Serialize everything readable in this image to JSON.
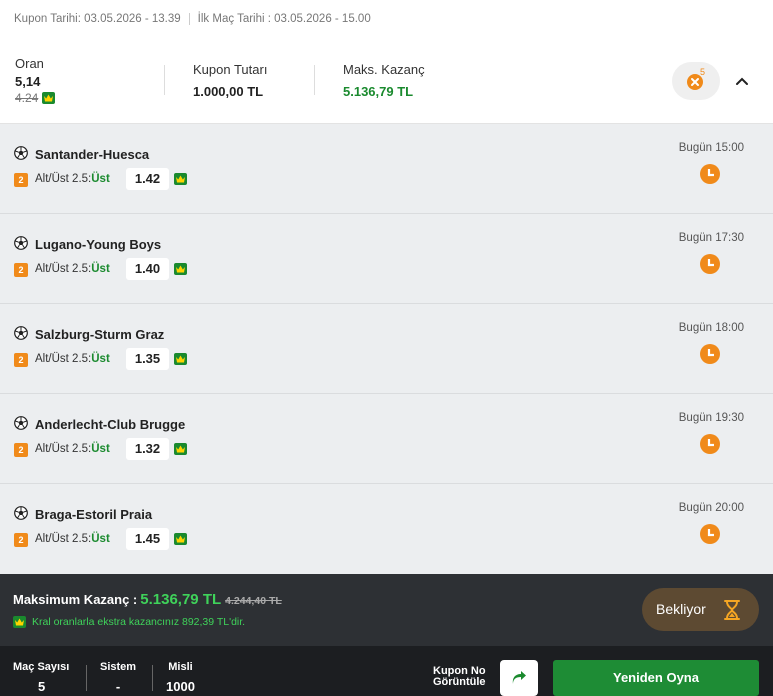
{
  "header": {
    "coupon_date": "Kupon Tarihi: 03.05.2026 - 13.39",
    "first_match_label": "İlk Maç Tarihi : ",
    "first_match_value": "03.05.2026 - 15.00"
  },
  "summary": {
    "odds_label": "Oran",
    "odds_value": "5,14",
    "odds_old": "4.24",
    "stake_label": "Kupon Tutarı",
    "stake_value": "1.000,00 TL",
    "max_win_label": "Maks. Kazanç",
    "max_win_value": "5.136,79 TL",
    "share_count": "5"
  },
  "matches": [
    {
      "name": "Santander-Huesca",
      "count": "2",
      "market": "Alt/Üst 2.5:",
      "pick": "Üst",
      "odd": "1.42",
      "time": "Bugün 15:00"
    },
    {
      "name": "Lugano-Young Boys",
      "count": "2",
      "market": "Alt/Üst 2.5:",
      "pick": "Üst",
      "odd": "1.40",
      "time": "Bugün 17:30"
    },
    {
      "name": "Salzburg-Sturm Graz",
      "count": "2",
      "market": "Alt/Üst 2.5:",
      "pick": "Üst",
      "odd": "1.35",
      "time": "Bugün 18:00"
    },
    {
      "name": "Anderlecht-Club Brugge",
      "count": "2",
      "market": "Alt/Üst 2.5:",
      "pick": "Üst",
      "odd": "1.32",
      "time": "Bugün 19:30"
    },
    {
      "name": "Braga-Estoril Praia",
      "count": "2",
      "market": "Alt/Üst 2.5:",
      "pick": "Üst",
      "odd": "1.45",
      "time": "Bugün 20:00"
    }
  ],
  "footer": {
    "max_win_label": "Maksimum Kazanç :",
    "max_win_value": "5.136,79 TL",
    "max_win_old": "4.244,40 TL",
    "bonus_text": "Kral oranlarla ekstra kazancınız 892,39 TL'dir.",
    "status_label": "Bekliyor"
  },
  "bottom": {
    "match_count_label": "Maç Sayısı",
    "match_count_value": "5",
    "system_label": "Sistem",
    "system_value": "-",
    "multiplier_label": "Misli",
    "multiplier_value": "1000",
    "coupon_no_line1": "Kupon No",
    "coupon_no_line2": "Görüntüle",
    "replay_label": "Yeniden Oyna"
  },
  "colors": {
    "accent_green": "#1a8a2e",
    "accent_orange": "#f08a1a",
    "footer_bg": "#2d3034",
    "bonus_green": "#3fd25a"
  },
  "icons": {
    "sport": "soccer-ball-icon",
    "status": "clock-icon",
    "crown": "crown-icon",
    "share": "share-arrow-icon",
    "waiting": "hourglass-icon",
    "collapse": "chevron-up-icon"
  }
}
